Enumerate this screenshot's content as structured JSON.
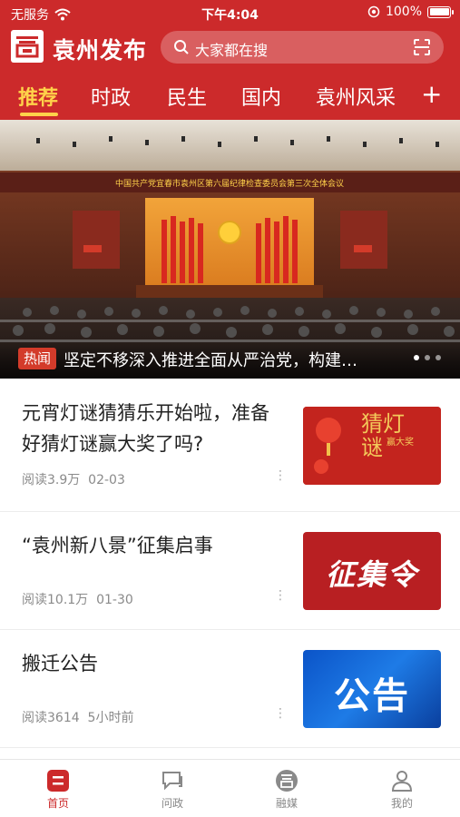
{
  "status_bar": {
    "carrier": "无服务",
    "time": "下午4:04",
    "battery": "100%"
  },
  "header": {
    "app_name": "袁州发布",
    "search_placeholder": "大家都在搜"
  },
  "tabs": [
    {
      "label": "推荐",
      "active": true
    },
    {
      "label": "时政"
    },
    {
      "label": "民生"
    },
    {
      "label": "国内"
    },
    {
      "label": "袁州风采"
    }
  ],
  "banner": {
    "tag": "热闻",
    "caption": "坚定不移深入推进全面从严治党，构建…",
    "slide_text": "中国共产党宜春市袁州区第六届纪律检查委员会第三次全体会议"
  },
  "feed": [
    {
      "title": "元宵灯谜猜猜乐开始啦，准备好猜灯谜赢大奖了吗?",
      "reads": "阅读3.9万",
      "date": "02-03",
      "thumb_text": "猜灯谜",
      "thumb_sub": "赢大奖"
    },
    {
      "title": "“袁州新八景”征集启事",
      "reads": "阅读10.1万",
      "date": "01-30",
      "thumb_text": "征集令"
    },
    {
      "title": "搬迁公告",
      "reads": "阅读3614",
      "date": "5小时前",
      "thumb_text": "公告"
    }
  ],
  "bottom_nav": [
    {
      "label": "首页",
      "icon": "home-icon",
      "active": true
    },
    {
      "label": "问政",
      "icon": "chat-icon"
    },
    {
      "label": "融媒",
      "icon": "media-icon"
    },
    {
      "label": "我的",
      "icon": "user-icon"
    }
  ],
  "colors": {
    "brand_red": "#cc2a2b",
    "tab_active": "#ffd24a"
  }
}
